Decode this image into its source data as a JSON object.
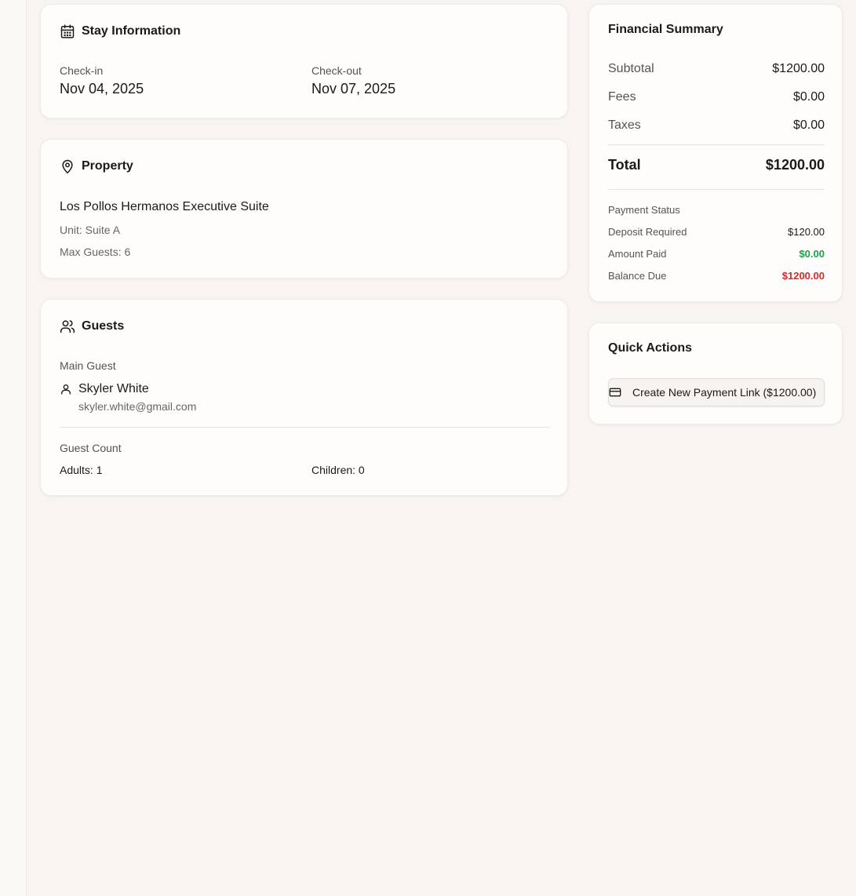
{
  "stay": {
    "title": "Stay Information",
    "checkin_label": "Check-in",
    "checkin_value": "Nov 04, 2025",
    "checkout_label": "Check-out",
    "checkout_value": "Nov 07, 2025"
  },
  "property": {
    "title": "Property",
    "name": "Los Pollos Hermanos Executive Suite",
    "unit": "Unit: Suite A",
    "max_guests": "Max Guests: 6"
  },
  "guests": {
    "title": "Guests",
    "main_label": "Main Guest",
    "main_name": "Skyler White",
    "main_email": "skyler.white@gmail.com",
    "count_label": "Guest Count",
    "adults": "Adults: 1",
    "children": "Children: 0"
  },
  "financial": {
    "title": "Financial Summary",
    "subtotal_label": "Subtotal",
    "subtotal_value": "$1200.00",
    "fees_label": "Fees",
    "fees_value": "$0.00",
    "taxes_label": "Taxes",
    "taxes_value": "$0.00",
    "total_label": "Total",
    "total_value": "$1200.00",
    "payment_status_label": "Payment Status",
    "deposit_label": "Deposit Required",
    "deposit_value": "$120.00",
    "paid_label": "Amount Paid",
    "paid_value": "$0.00",
    "balance_label": "Balance Due",
    "balance_value": "$1200.00"
  },
  "quick_actions": {
    "title": "Quick Actions",
    "create_link_label": "Create New Payment Link ($1200.00)"
  },
  "colors": {
    "paid": "#16a34a",
    "balance": "#dc2626",
    "background": "#f8f4f1",
    "card": "#fefdfb"
  },
  "icons": {
    "stay": "calendar-icon",
    "property": "map-pin-icon",
    "guests": "users-icon",
    "main_guest": "user-icon",
    "create_link": "credit-card-icon"
  }
}
